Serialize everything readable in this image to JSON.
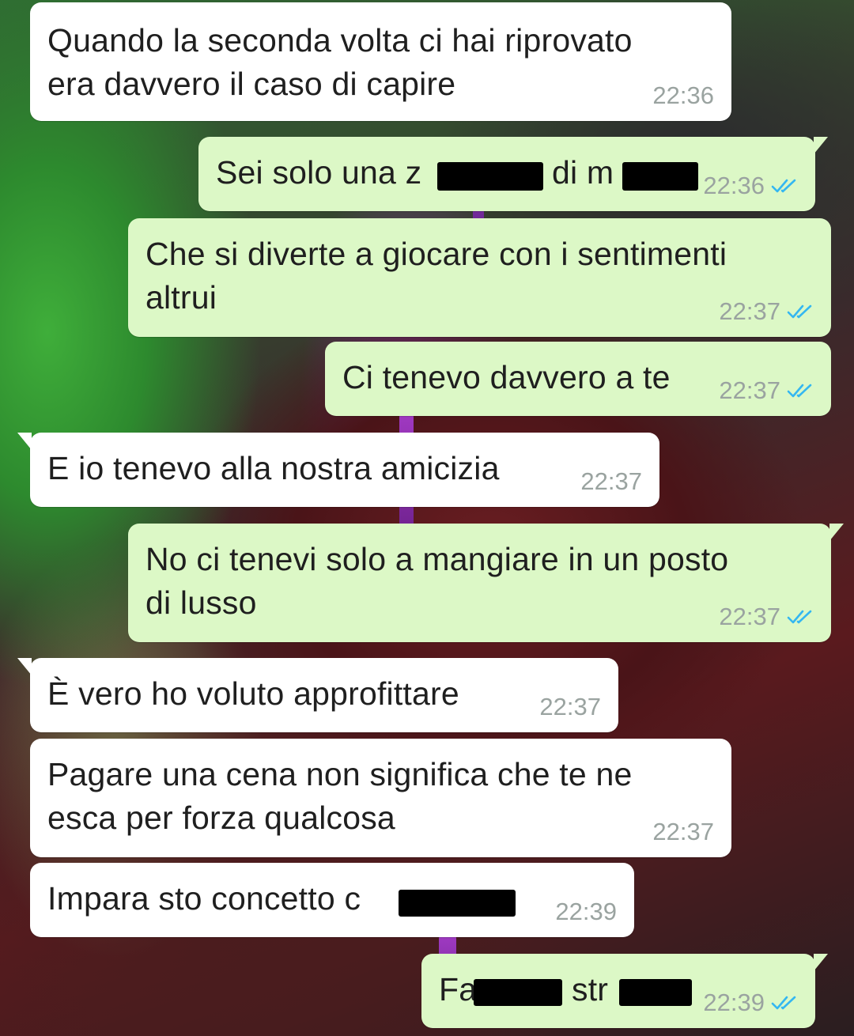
{
  "chat": {
    "messages": [
      {
        "id": 1,
        "direction": "incoming",
        "lines": [
          "Quando la seconda volta ci hai riprovato",
          "era davvero il caso di capire"
        ],
        "time": "22:36"
      },
      {
        "id": 2,
        "direction": "outgoing",
        "text": "Sei solo una z",
        "text2": "di m",
        "time": "22:36",
        "status": "read"
      },
      {
        "id": 3,
        "direction": "outgoing",
        "lines": [
          "Che si diverte a giocare con i sentimenti",
          "altrui"
        ],
        "time": "22:37",
        "status": "read"
      },
      {
        "id": 4,
        "direction": "outgoing",
        "text": "Ci tenevo davvero a te",
        "time": "22:37",
        "status": "read"
      },
      {
        "id": 5,
        "direction": "incoming",
        "text": "E io tenevo alla nostra amicizia",
        "time": "22:37"
      },
      {
        "id": 6,
        "direction": "outgoing",
        "lines": [
          "No ci tenevi solo a mangiare in un posto",
          "di lusso"
        ],
        "time": "22:37",
        "status": "read"
      },
      {
        "id": 7,
        "direction": "incoming",
        "text": "È vero ho voluto approfittare",
        "time": "22:37"
      },
      {
        "id": 8,
        "direction": "incoming",
        "lines": [
          "Pagare una cena non significa che te ne",
          "esca per forza qualcosa"
        ],
        "time": "22:37"
      },
      {
        "id": 9,
        "direction": "incoming",
        "text": "Impara sto concetto c",
        "time": "22:39"
      },
      {
        "id": 10,
        "direction": "outgoing",
        "text": "Fa",
        "text2": "str",
        "time": "22:39",
        "status": "read"
      }
    ]
  },
  "colors": {
    "incoming_bubble": "#ffffff",
    "outgoing_bubble": "#dcf8c6",
    "read_ticks": "#34b7f1",
    "timestamp": "#9aa3a0",
    "redaction": "#000000"
  },
  "icons": {
    "read_status": "double-check-icon"
  }
}
